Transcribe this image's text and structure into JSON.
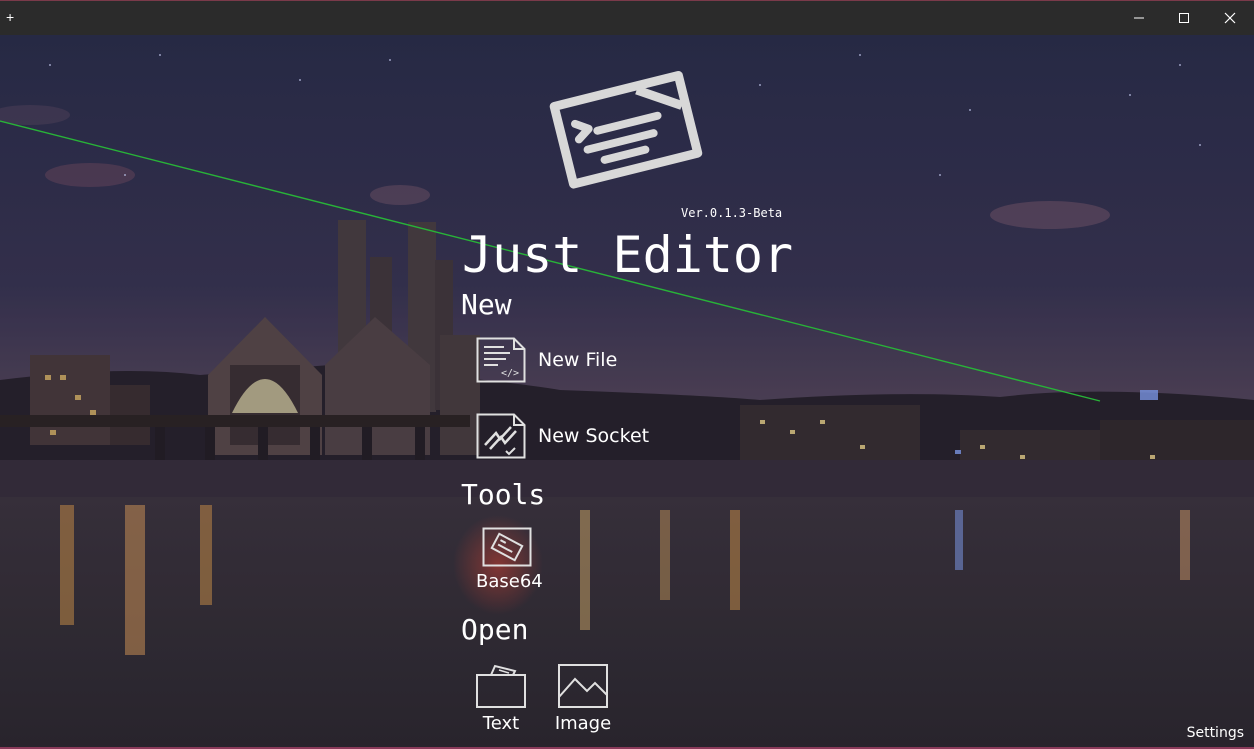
{
  "titlebar": {
    "new_tab_glyph": "+",
    "minimize_icon": "minimize-icon",
    "maximize_icon": "maximize-icon",
    "close_icon": "close-icon"
  },
  "app": {
    "version": "Ver.0.1.3-Beta",
    "title": "Just Editor",
    "logo_icon": "editor-logo-icon"
  },
  "sections": {
    "new": "New",
    "tools": "Tools",
    "open": "Open"
  },
  "new_items": {
    "new_file": {
      "label": "New File",
      "icon": "new-file-icon"
    },
    "new_socket": {
      "label": "New Socket",
      "icon": "socket-icon"
    }
  },
  "tools_items": {
    "base64": {
      "label": "Base64",
      "icon": "base64-icon"
    }
  },
  "open_items": {
    "text": {
      "label": "Text",
      "icon": "folder-icon"
    },
    "image": {
      "label": "Image",
      "icon": "image-icon"
    }
  },
  "footer": {
    "settings": "Settings"
  },
  "colors": {
    "titlebar": "#2b2b2b",
    "accent_border": "#8a3a5a",
    "laser": "#2ecc40",
    "text": "#ffffff"
  }
}
